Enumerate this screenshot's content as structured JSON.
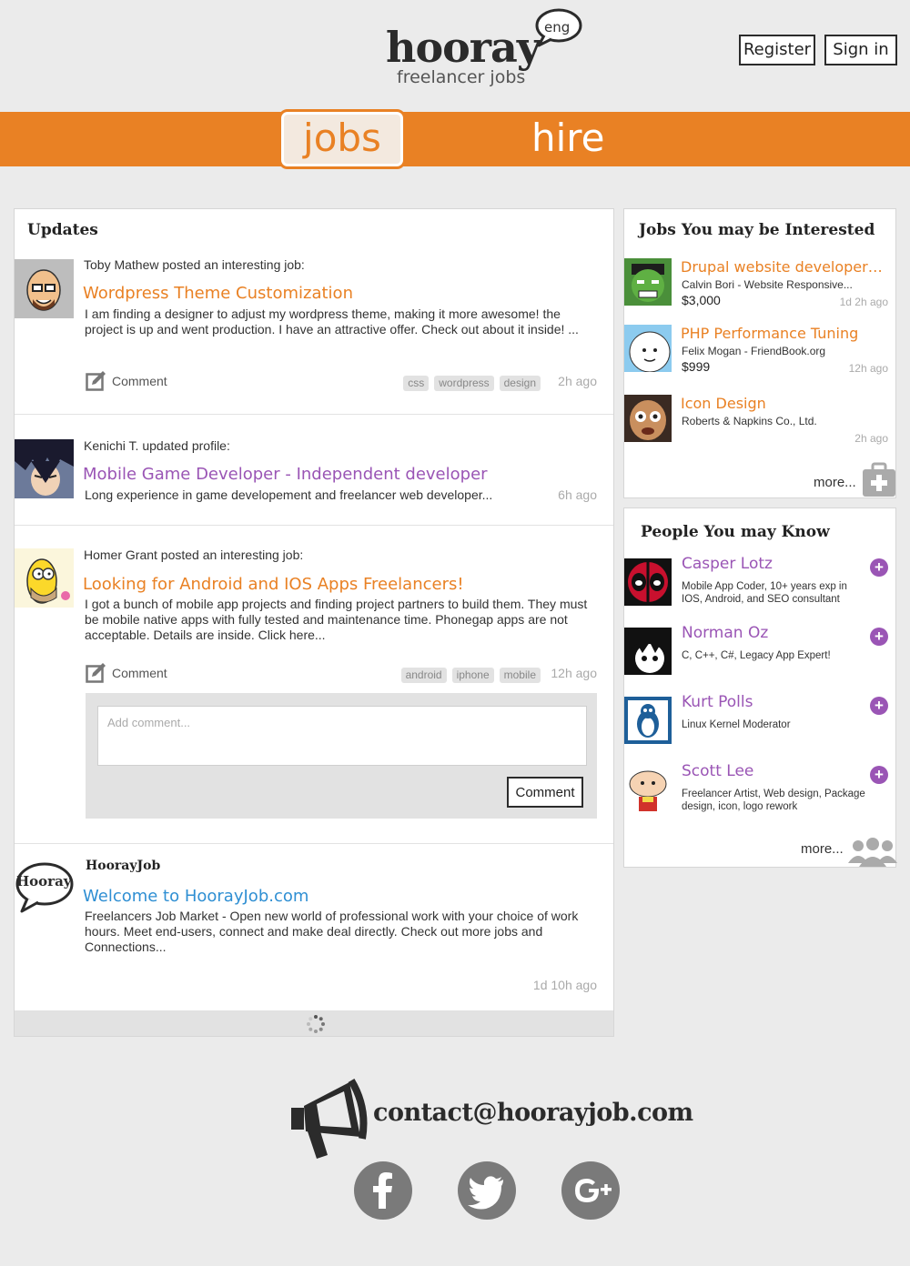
{
  "header": {
    "logo_word": "hooray",
    "logo_sub": "freelancer jobs",
    "lang_badge": "eng",
    "register_label": "Register",
    "signin_label": "Sign in"
  },
  "nav": {
    "tabs": [
      {
        "label": "jobs",
        "active": true
      },
      {
        "label": "hire",
        "active": false
      }
    ],
    "accent_color": "#e98124"
  },
  "updates": {
    "title": "Updates",
    "items": [
      {
        "who": "Toby Mathew posted an interesting job:",
        "title": "Wordpress Theme Customization",
        "body": "I am finding a designer to adjust my wordpress theme, making it more awesome! the project is up and went production. I have an attractive offer. Check out about it inside! ...",
        "comment_label": "Comment",
        "tags": [
          "css",
          "wordpress",
          "design"
        ],
        "ago": "2h ago"
      },
      {
        "who": "Kenichi T.  updated profile:",
        "title": "Mobile Game Developer - Independent developer",
        "body": "Long experience in game developement and freelancer web developer...",
        "ago": "6h ago"
      },
      {
        "who": "Homer Grant  posted an interesting job:",
        "title": "Looking for Android and IOS Apps Freelancers!",
        "body": "I got a bunch of mobile app projects and finding project partners to build them. They must be mobile native apps with fully tested and maintenance time. Phonegap apps are not acceptable. Details are inside. Click here...",
        "comment_label": "Comment",
        "tags": [
          "android",
          "iphone",
          "mobile"
        ],
        "ago": "12h ago",
        "comment_placeholder": "Add comment...",
        "comment_submit": "Comment"
      },
      {
        "who": "HoorayJob",
        "logo_text": "Hooray",
        "title": "Welcome to HoorayJob.com",
        "body": "Freelancers Job Market - Open new world of professional work with your choice of work hours. Meet end-users, connect and make deal directly. Check out more jobs and Connections...",
        "ago": "1d 10h ago"
      }
    ]
  },
  "jobs_panel": {
    "title": "Jobs You may be Interested",
    "items": [
      {
        "title": "Drupal website developer n...",
        "company": "Calvin Bori - Website Responsive...",
        "price": "$3,000",
        "ago": "1d 2h ago",
        "thumb": "hulk-avatar"
      },
      {
        "title": "PHP Performance Tuning",
        "company": "Felix Mogan - FriendBook.org",
        "price": "$999",
        "ago": "12h ago",
        "thumb": "finn-avatar"
      },
      {
        "title": "Icon Design",
        "company": "Roberts & Napkins Co., Ltd.",
        "price": "",
        "ago": "2h ago",
        "thumb": "face-avatar"
      }
    ],
    "more_label": "more..."
  },
  "people_panel": {
    "title": "People You may Know",
    "items": [
      {
        "name": "Casper Lotz",
        "desc": "Mobile App Coder, 10+ years exp in IOS, Android, and SEO consultant"
      },
      {
        "name": "Norman Oz",
        "desc": "C, C++, C#, Legacy App Expert!"
      },
      {
        "name": "Kurt Polls",
        "desc": "Linux Kernel Moderator"
      },
      {
        "name": "Scott Lee",
        "desc": "Freelancer Artist, Web design, Package design, icon, logo rework"
      }
    ],
    "add_symbol": "+",
    "more_label": "more..."
  },
  "footer": {
    "contact": "contact@hoorayjob.com",
    "social": [
      "facebook-icon",
      "twitter-icon",
      "google-plus-icon"
    ]
  },
  "colors": {
    "accent": "#e98124",
    "purple": "#9a55b5",
    "blue": "#2f8fd3",
    "dark": "#2b2b2b"
  }
}
